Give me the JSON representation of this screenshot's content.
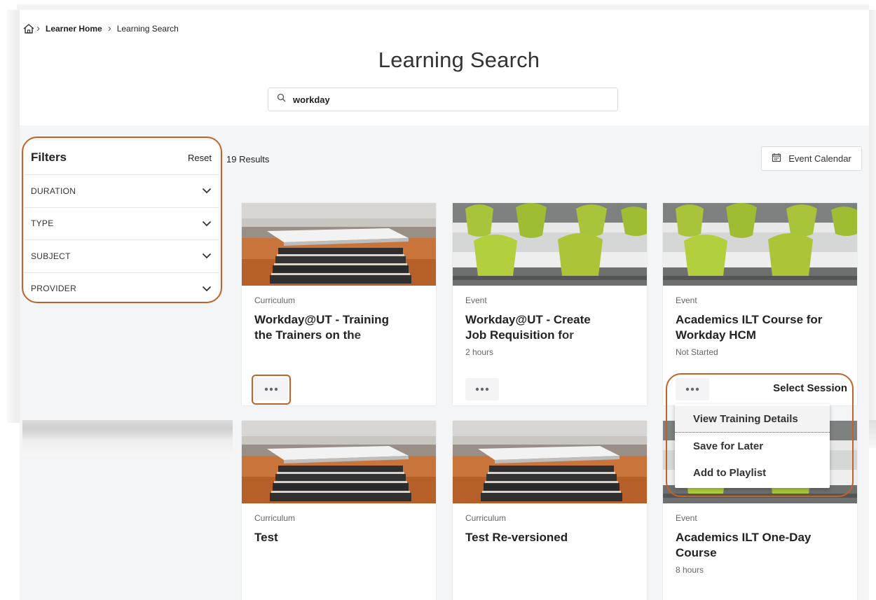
{
  "breadcrumb": {
    "items": [
      "Learner Home",
      "Learning Search"
    ]
  },
  "page": {
    "title": "Learning Search"
  },
  "search": {
    "value": "workday",
    "icon": "search-icon"
  },
  "filters": {
    "title": "Filters",
    "reset_label": "Reset",
    "groups": [
      "DURATION",
      "TYPE",
      "SUBJECT",
      "PROVIDER"
    ]
  },
  "results": {
    "count_label": "19 Results"
  },
  "toolbar": {
    "calendar_label": "Event Calendar",
    "calendar_icon": "calendar-icon"
  },
  "cards": [
    {
      "type": "Curriculum",
      "title_line1": "Workday@UT - Training",
      "title_line2": "the Trainers on the",
      "meta": "",
      "image": "books-tablet"
    },
    {
      "type": "Event",
      "title_line1": "Workday@UT - Create",
      "title_line2": "Job Requisition for",
      "meta": "2 hours",
      "image": "classroom-chairs"
    },
    {
      "type": "Event",
      "title_line1": "Academics ILT Course for",
      "title_line2": "Workday HCM",
      "meta": "Not Started",
      "image": "classroom-chairs",
      "action_label": "Select Session"
    },
    {
      "type": "Curriculum",
      "title_line1": "Test",
      "title_line2": "",
      "meta": "",
      "image": "books-tablet"
    },
    {
      "type": "Curriculum",
      "title_line1": "Test Re-versioned",
      "title_line2": "",
      "meta": "",
      "image": "books-tablet"
    },
    {
      "type": "Event",
      "title_line1": "Academics ILT One-Day",
      "title_line2": "Course",
      "meta": "8 hours",
      "image": "classroom-chairs"
    }
  ],
  "context_menu": {
    "items": [
      "View Training Details",
      "Save for Later",
      "Add to Playlist"
    ]
  },
  "colors": {
    "highlight": "#c0622a",
    "chair_green": "#a8c43a",
    "page_bg": "#f4f5f7"
  }
}
